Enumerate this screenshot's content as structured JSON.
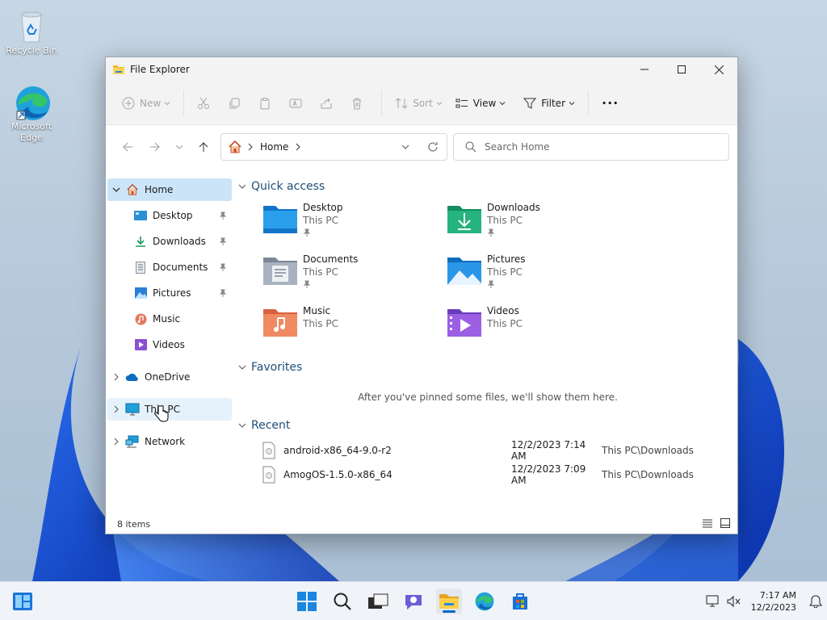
{
  "desktop": {
    "icons": [
      {
        "label": "Recycle Bin",
        "icon": "recycle-bin-icon"
      },
      {
        "label": "Microsoft Edge",
        "icon": "edge-icon"
      }
    ]
  },
  "window": {
    "title": "File Explorer",
    "controls": {
      "minimize": "minimize-icon",
      "maximize": "maximize-icon",
      "close": "close-icon"
    }
  },
  "commandbar": {
    "new_label": "New",
    "sort_label": "Sort",
    "view_label": "View",
    "filter_label": "Filter",
    "more_label": "..."
  },
  "navbar": {
    "address_crumb": "Home",
    "search_placeholder": "Search Home"
  },
  "sidebar": {
    "home": "Home",
    "pinned": [
      {
        "label": "Desktop",
        "pinned": true
      },
      {
        "label": "Downloads",
        "pinned": true
      },
      {
        "label": "Documents",
        "pinned": true
      },
      {
        "label": "Pictures",
        "pinned": true
      },
      {
        "label": "Music",
        "pinned": false
      },
      {
        "label": "Videos",
        "pinned": false
      }
    ],
    "onedrive": "OneDrive",
    "thispc": "This PC",
    "network": "Network"
  },
  "content": {
    "quick_access": {
      "heading": "Quick access",
      "items": [
        {
          "name": "Desktop",
          "location": "This PC",
          "pinned": true
        },
        {
          "name": "Downloads",
          "location": "This PC",
          "pinned": true
        },
        {
          "name": "Documents",
          "location": "This PC",
          "pinned": true
        },
        {
          "name": "Pictures",
          "location": "This PC",
          "pinned": true
        },
        {
          "name": "Music",
          "location": "This PC",
          "pinned": false
        },
        {
          "name": "Videos",
          "location": "This PC",
          "pinned": false
        }
      ]
    },
    "favorites": {
      "heading": "Favorites",
      "empty_message": "After you've pinned some files, we'll show them here."
    },
    "recent": {
      "heading": "Recent",
      "rows": [
        {
          "name": "android-x86_64-9.0-r2",
          "date": "12/2/2023 7:14 AM",
          "location": "This PC\\Downloads"
        },
        {
          "name": "AmogOS-1.5.0-x86_64",
          "date": "12/2/2023 7:09 AM",
          "location": "This PC\\Downloads"
        }
      ]
    }
  },
  "status": {
    "items_count": "8 items"
  },
  "taskbar": {
    "time": "7:17 AM",
    "date": "12/2/2023",
    "accent": "#0067c0"
  }
}
